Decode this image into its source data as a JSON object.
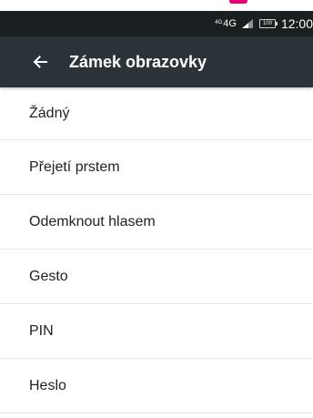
{
  "colors": {
    "status_bar": "#1a1f22",
    "app_bar": "#2b3338",
    "accent_notch": "#e20074"
  },
  "status_bar": {
    "network_prefix": "4G",
    "network_type": "4G",
    "battery_label": "100",
    "time": "12:00",
    "icons": [
      "signal-icon",
      "battery-icon"
    ]
  },
  "header": {
    "back_icon": "arrow-left-icon",
    "title": "Zámek obrazovky"
  },
  "menu": {
    "items": [
      {
        "label": "Žádný"
      },
      {
        "label": "Přejetí prstem"
      },
      {
        "label": "Odemknout hlasem"
      },
      {
        "label": "Gesto"
      },
      {
        "label": "PIN"
      },
      {
        "label": "Heslo"
      }
    ]
  }
}
